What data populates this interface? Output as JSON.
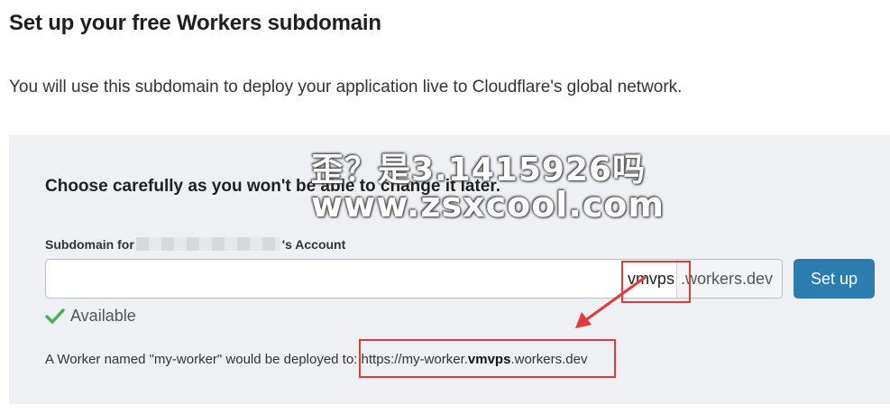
{
  "page": {
    "title": "Set up your free Workers subdomain",
    "subtitle": "You will use this subdomain to deploy your application live to Cloudflare's global network."
  },
  "panel": {
    "warning": "Choose carefully as you won't be able to change it later.",
    "field_label_prefix": "Subdomain for",
    "field_label_suffix": "'s Account",
    "subdomain_value": "vmvps",
    "addon_suffix": ".workers.dev",
    "setup_button": "Set up",
    "status_text": "Available",
    "status_icon": "check-icon",
    "status_color": "#4caf50",
    "note_prefix": "A Worker named \"my-worker\" would be deployed to:",
    "note_url_start": "https://my-worker.",
    "note_url_sub": "vmvps",
    "note_url_end": ".workers.dev"
  },
  "watermark": {
    "line1": "歪？是3.1415926吗",
    "line2": "www.zsxcool.com"
  },
  "colors": {
    "accent": "#2c7cb0",
    "panel_bg": "#eef0f4",
    "annotation_red": "#e03a3a"
  }
}
